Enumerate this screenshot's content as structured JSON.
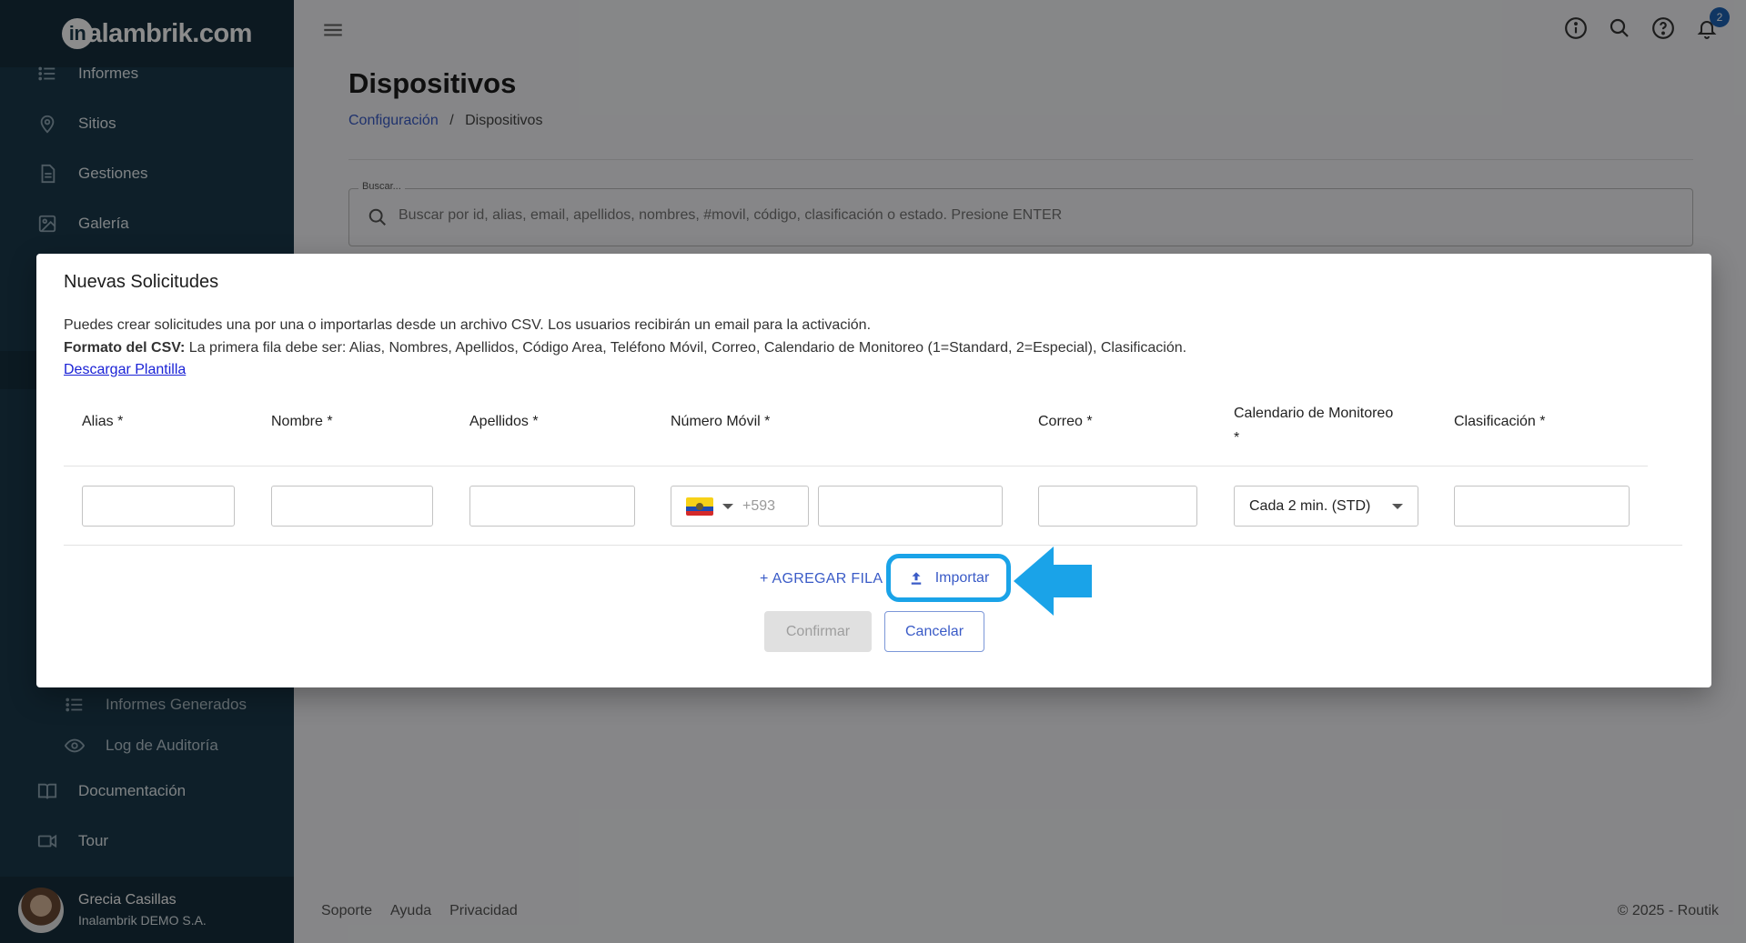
{
  "app": {
    "logo_text": "inalambrik.com",
    "logo_letter": "in"
  },
  "sidebar": {
    "items": [
      {
        "label": "Informes",
        "icon": "list-icon"
      },
      {
        "label": "Sitios",
        "icon": "location-pin-icon"
      },
      {
        "label": "Gestiones",
        "icon": "document-icon"
      },
      {
        "label": "Galería",
        "icon": "image-icon"
      }
    ],
    "sub_items": [
      {
        "label": "Informes Generados",
        "icon": "list-icon"
      },
      {
        "label": "Log de Auditoría",
        "icon": "eye-icon"
      }
    ],
    "bottom_items": [
      {
        "label": "Documentación",
        "icon": "book-icon"
      },
      {
        "label": "Tour",
        "icon": "video-camera-icon"
      }
    ],
    "user": {
      "name": "Grecia Casillas",
      "org": "Inalambrik DEMO S.A."
    }
  },
  "topbar": {
    "notification_count": "2"
  },
  "page": {
    "title": "Dispositivos",
    "breadcrumb": {
      "link": "Configuración",
      "separator": "/",
      "current": "Dispositivos"
    },
    "search": {
      "label": "Buscar...",
      "placeholder": "Buscar por id, alias, email, apellidos, nombres, #movil, código, clasificación o estado. Presione ENTER"
    }
  },
  "footer": {
    "links": [
      "Soporte",
      "Ayuda",
      "Privacidad"
    ],
    "copyright": "© 2025 - Routik"
  },
  "dialog": {
    "title": "Nuevas Solicitudes",
    "description": "Puedes crear solicitudes una por una o importarlas desde un archivo CSV. Los usuarios recibirán un email para la activación.",
    "csv_format_label": "Formato del CSV:",
    "csv_format_text": " La primera fila debe ser: Alias, Nombres, Apellidos, Código Area, Teléfono Móvil, Correo, Calendario de Monitoreo (1=Standard, 2=Especial), Clasificación.",
    "download_link": "Descargar Plantilla",
    "columns": {
      "alias": "Alias *",
      "nombre": "Nombre *",
      "apellidos": "Apellidos *",
      "numero_movil": "Número Móvil *",
      "correo": "Correo *",
      "calendario_line1": "Calendario de Monitoreo",
      "calendario_line2": "*",
      "clasificacion": "Clasificación *"
    },
    "row": {
      "phone_code": "+593",
      "calendario_value": "Cada 2 min. (STD)"
    },
    "add_row_label": "+ AGREGAR FILA",
    "import_label": "Importar",
    "confirm_label": "Confirmar",
    "cancel_label": "Cancelar"
  },
  "colors": {
    "sidebar": "#1b3a4b",
    "primary": "#3a5bc7",
    "highlight": "#1aa3e8",
    "link": "#1a22d6"
  }
}
